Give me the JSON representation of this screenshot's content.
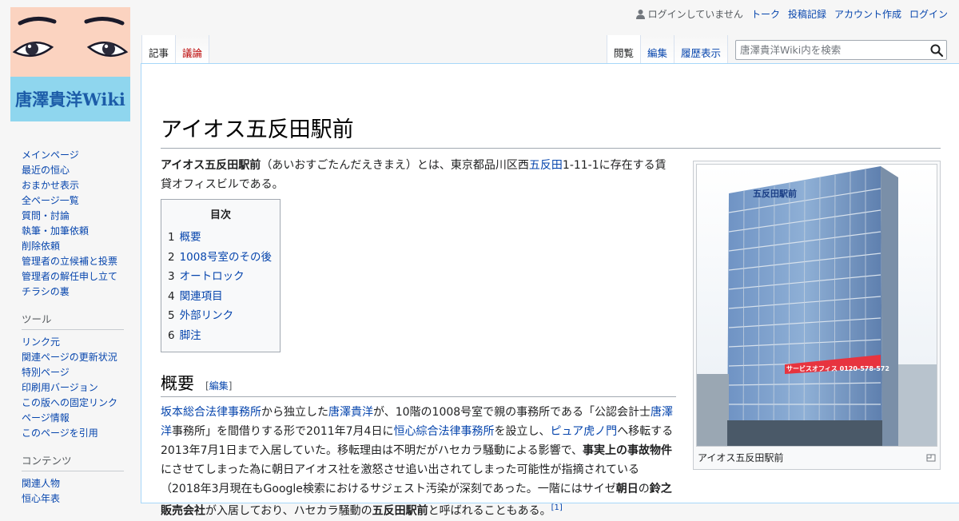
{
  "logo": {
    "text": "唐澤貴洋Wiki"
  },
  "personal": {
    "anon": "ログインしていません",
    "talk": "トーク",
    "contribs": "投稿記録",
    "create": "アカウント作成",
    "login": "ログイン"
  },
  "tabs": {
    "article": "記事",
    "talk": "議論",
    "read": "閲覧",
    "edit": "編集",
    "history": "履歴表示"
  },
  "search": {
    "placeholder": "唐澤貴洋Wiki内を検索"
  },
  "sidebar": {
    "nav": [
      "メインページ",
      "最近の恒心",
      "おまかせ表示",
      "全ページ一覧",
      "質問・討論",
      "執筆・加筆依頼",
      "削除依頼",
      "管理者の立候補と投票",
      "管理者の解任申し立て",
      "チラシの裏"
    ],
    "tools_heading": "ツール",
    "tools": [
      "リンク元",
      "関連ページの更新状況",
      "特別ページ",
      "印刷用バージョン",
      "この版への固定リンク",
      "ページ情報",
      "このページを引用"
    ],
    "contents_heading": "コンテンツ",
    "contents": [
      "関連人物",
      "恒心年表"
    ]
  },
  "page": {
    "title": "アイオス五反田駅前",
    "intro": {
      "bold": "アイオス五反田駅前",
      "t1": "（あいおすごたんだえきまえ）とは、東京都品川区西",
      "link": "五反田",
      "t2": "1-11-1に存在する賃貸オフィスビルである。"
    },
    "toc": {
      "title": "目次",
      "items": [
        {
          "num": "1",
          "label": "概要"
        },
        {
          "num": "2",
          "label": "1008号室のその後"
        },
        {
          "num": "3",
          "label": "オートロック"
        },
        {
          "num": "4",
          "label": "関連項目"
        },
        {
          "num": "5",
          "label": "外部リンク"
        },
        {
          "num": "6",
          "label": "脚注"
        }
      ]
    },
    "section": {
      "heading": "概要",
      "edit": "編集"
    },
    "para": {
      "l1": "坂本総合法律事務所",
      "t1": "から独立した",
      "l2": "唐澤貴洋",
      "t2": "が、10階の1008号室で親の事務所である「公認会計士",
      "l3": "唐澤洋",
      "t3": "事務所」を間借りする形で2011年7月4日に",
      "l4": "恒心綜合法律事務所",
      "t4": "を設立し、",
      "l5": "ピュア虎ノ門",
      "t5": "へ移転する2013年7月1日まで入居していた。移転理由は不明だがハセカラ騒動による影響で、",
      "b1": "事実上の事故物件",
      "t6": "にさせてしまった為に朝日アイオス社を激怒させ追い出されてしまった可能性が指摘されている（2018年3月現在もGoogle検索におけるサジェスト汚染が深刻であった。一階にはサイゼ",
      "b2": "朝日",
      "t7": "の",
      "b3": "鈴之販売会社",
      "t8": "が入居しており、ハセカラ騒動の",
      "b4": "五反田駅前",
      "t9": "と呼ばれることもある。",
      "ref": "[1]"
    },
    "thumb": {
      "sign_top": "五反田駅前",
      "sign_banner": "サービスオフィス 0120-578-572",
      "caption": "アイオス五反田駅前"
    }
  },
  "colors": {
    "link": "#0645ad",
    "new_link": "#ba0000",
    "border": "#a7d7f9"
  }
}
